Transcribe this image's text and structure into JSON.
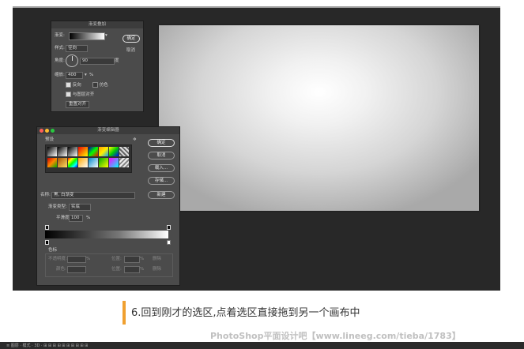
{
  "gradient_options_dialog": {
    "title": "渐变叠加",
    "gradient_label": "渐变:",
    "style_label": "样式:",
    "style_value": "径向",
    "angle_label": "角度:",
    "angle_value": "90",
    "angle_unit": "度",
    "scale_label": "缩放:",
    "scale_value": "400",
    "scale_unit": "%",
    "reverse_label": "反向",
    "dither_label": "仿色",
    "align_layer_label": "与图层对齐",
    "reset_alignment_label": "重置对齐",
    "ok_label": "确定",
    "cancel_label": "取消"
  },
  "gradient_editor": {
    "title": "渐变编辑器",
    "presets_label": "预设",
    "ok_label": "确定",
    "cancel_label": "取消",
    "load_label": "载入...",
    "save_label": "存储...",
    "name_label": "名称:",
    "name_value": "黑, 白渐变",
    "new_label": "新建",
    "type_label": "渐变类型:",
    "type_value": "实底",
    "smoothness_label": "平滑度:",
    "smoothness_value": "100",
    "smoothness_unit": "%",
    "stops_label": "色标",
    "opacity_label": "不透明度:",
    "opacity_unit": "%",
    "location_label": "位置:",
    "location_unit": "%",
    "delete_label": "删除",
    "color_label": "颜色:"
  },
  "caption": {
    "text": "6.回到刚才的选区,点着选区直接拖到另一个画布中",
    "accent_color": "#f0a030"
  },
  "watermark": "PhotoShop平面设计吧【www.lineeg.com/tieba/1783】",
  "taskbar": {
    "text": "≡ 图层 · 模式 · 3D · ⊞ ⊞ ⊞ ⊞ ⊞ ⊞ ⊞ ⊞ ⊞ ⊞"
  }
}
